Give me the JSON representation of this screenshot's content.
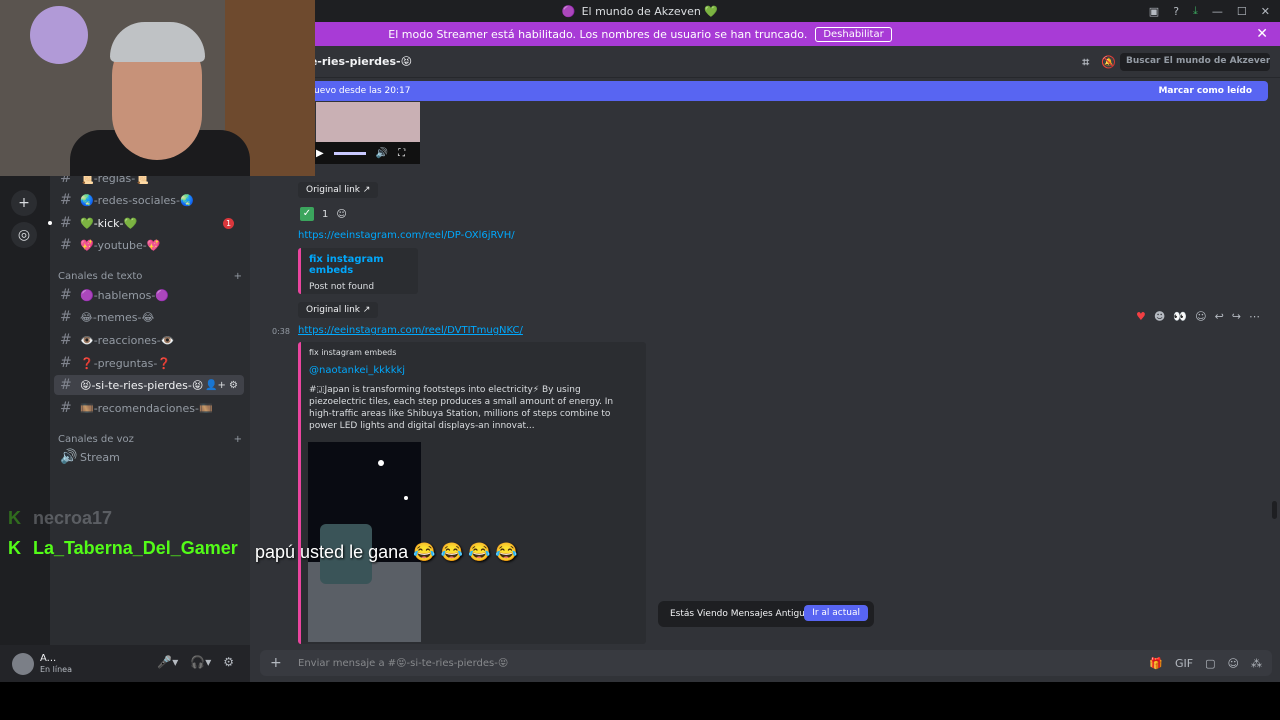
{
  "window": {
    "title": "El mundo de Akzeven 💚",
    "icons": [
      "inbox-icon",
      "help-icon",
      "download-icon",
      "minimize-icon",
      "maximize-icon",
      "close-icon"
    ]
  },
  "streamer_bar": {
    "text": "El modo Streamer está habilitado. Los nombres de usuario se han truncado.",
    "button": "Deshabilitar",
    "close": "✕"
  },
  "sidebar": {
    "channels_top": [
      {
        "label": "📜-reglas-📜",
        "unread": false
      },
      {
        "label": "🌏-redes-sociales-🌏",
        "unread": false
      },
      {
        "label": "💚-kick-💚",
        "unread": true,
        "badge": "1"
      },
      {
        "label": "💖-youtube-💖",
        "unread": false
      }
    ],
    "text_category": "Canales de texto",
    "text_channels": [
      {
        "label": "🟣-hablemos-🟣"
      },
      {
        "label": "😂-memes-😂"
      },
      {
        "label": "👁️-reacciones-👁️"
      },
      {
        "label": "❓-preguntas-❓"
      },
      {
        "label": "😝-si-te-ries-pierdes-😝",
        "active": true
      },
      {
        "label": "🎞️-recomendaciones-🎞️"
      }
    ],
    "voice_category": "Canales de voz",
    "voice_channels": [
      {
        "label": "Stream"
      }
    ]
  },
  "user": {
    "name": "A...",
    "status": "En línea"
  },
  "header": {
    "channel": "-te-ries-pierdes-😝",
    "search_placeholder": "Buscar El mundo de Akzeven 💚"
  },
  "new_messages": {
    "text": "uevo desde las 20:17",
    "mark_read": "Marcar como leído"
  },
  "messages": {
    "original_link": "Original link",
    "reaction_count": "1",
    "link1": "https://eeinstagram.com/reel/DP-OXl6jRVH/",
    "embed1": {
      "provider": "fix instagram embeds",
      "desc": "Post not found"
    },
    "timestamp": "0:38",
    "link2": "https://eeinstagram.com/reel/DVTITmugNKC/",
    "embed2": {
      "provider": "fix instagram embeds",
      "author": "@naotankei_kkkkkj",
      "text": "#🇯Japan is transforming footsteps into electricity⚡ By using piezoelectric tiles, each step produces a small amount of energy. In high-traffic areas like Shibuya Station, millions of steps combine to power LED lights and digital displays-an innovat..."
    }
  },
  "old_messages": {
    "text": "Estás Viendo Mensajes Antiguos",
    "button": "Ir al actual"
  },
  "composer": {
    "placeholder": "Enviar mensaje a #😝-si-te-ries-pierdes-😝"
  },
  "stream_chat": [
    {
      "user": "necroa17",
      "text": ""
    },
    {
      "user": "La_Taberna_Del_Gamer",
      "text": "papú usted le gana 😂 😂 😂 😂"
    }
  ],
  "colors": {
    "accent": "#5865f2",
    "streamer": "#a83bd6",
    "embed_border": "#eb459f",
    "link": "#00a8fc",
    "kick": "#53fc18"
  }
}
